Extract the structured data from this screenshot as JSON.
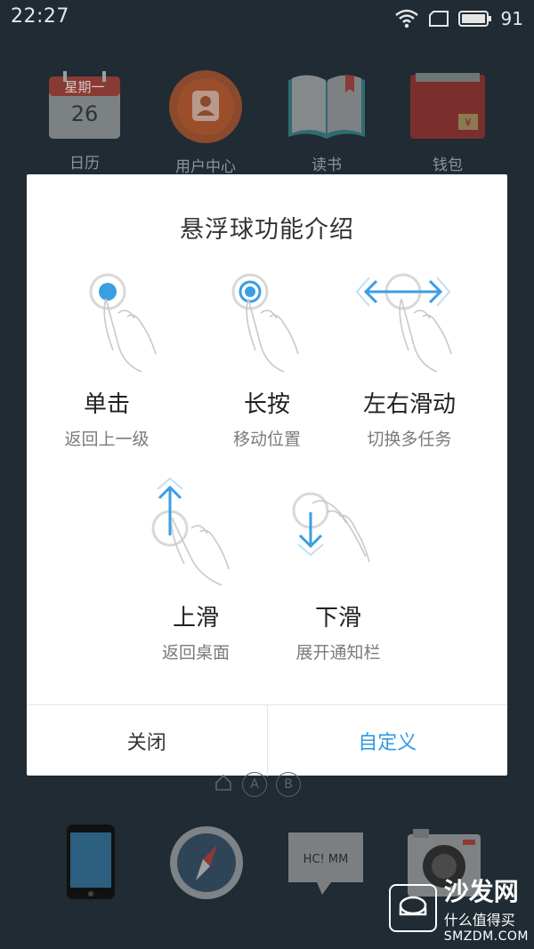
{
  "status_bar": {
    "time": "22:27",
    "battery": "91",
    "icons": [
      "wifi-icon",
      "screen-icon",
      "battery-icon"
    ]
  },
  "home_apps": [
    {
      "label": "日历",
      "calendar_weekday": "星期一",
      "calendar_day": "26"
    },
    {
      "label": "用户中心"
    },
    {
      "label": "读书"
    },
    {
      "label": "钱包"
    }
  ],
  "dialog": {
    "title": "悬浮球功能介绍",
    "gestures": [
      {
        "name": "单击",
        "desc": "返回上一级"
      },
      {
        "name": "长按",
        "desc": "移动位置"
      },
      {
        "name": "左右滑动",
        "desc": "切换多任务"
      },
      {
        "name": "上滑",
        "desc": "返回桌面"
      },
      {
        "name": "下滑",
        "desc": "展开通知栏"
      }
    ],
    "close_label": "关闭",
    "custom_label": "自定义"
  },
  "page_indicator": {
    "a": "A",
    "b": "B"
  },
  "dock": {
    "notes_text": "HC! MM"
  },
  "watermark": {
    "title": "沙发网",
    "subtitle": "什么值得买",
    "url": "SMZDM.COM"
  },
  "colors": {
    "accent": "#2f9be0",
    "wallpaper": "#202b33",
    "dialog": "#ffffff"
  }
}
